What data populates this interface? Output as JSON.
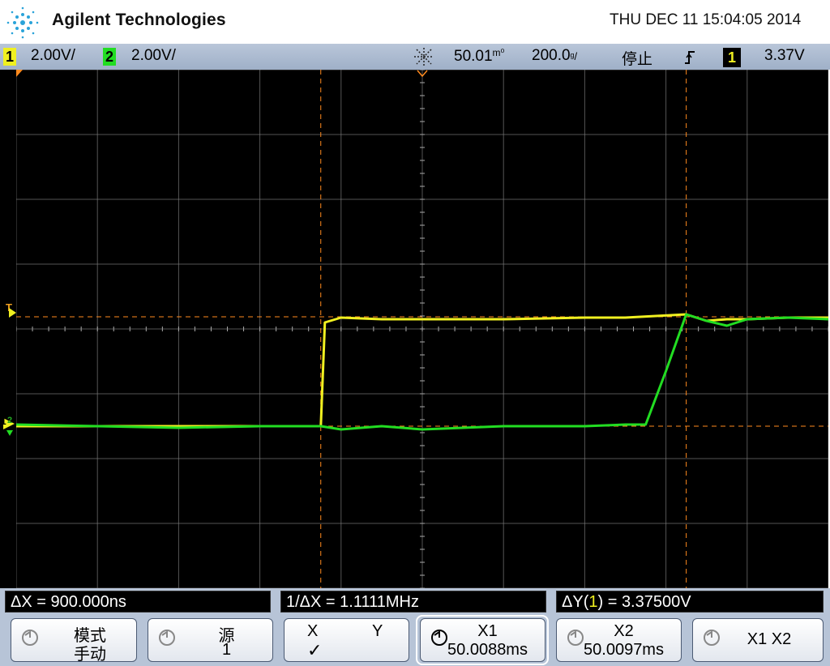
{
  "header": {
    "brand": "Agilent Technologies",
    "datetime": "THU DEC 11 15:04:05 2014"
  },
  "status": {
    "ch1_num": "1",
    "ch1_scale": "2.00V/",
    "ch2_num": "2",
    "ch2_scale": "2.00V/",
    "time_position": "50.01",
    "time_position_unit": "m⁰",
    "timebase": "200.0",
    "timebase_unit": "ᵍ/",
    "run_state": "停止",
    "trigger_slope_icon": "rising-edge-icon",
    "trigger_source": "1",
    "trigger_level": "3.37V"
  },
  "markers": {
    "trigger_level_marker": "T",
    "ch_ground_marker": "1",
    "ch2_ground_marker": "2"
  },
  "readouts": {
    "delta_x": "ΔX = 900.000ns",
    "inv_delta_x": "1/ΔX = 1.1111MHz",
    "delta_y_prefix": "ΔY(",
    "delta_y_channel": "1",
    "delta_y_suffix": ") = 3.37500V"
  },
  "softkeys": {
    "mode_label": "模式",
    "mode_value": "手动",
    "source_label": "源",
    "source_value": "1",
    "x_label": "X",
    "y_label": "Y",
    "x_check": "✓",
    "x1_label": "X1",
    "x1_value": "50.0088ms",
    "x2_label": "X2",
    "x2_value": "50.0097ms",
    "x1x2_label": "X1 X2"
  },
  "colors": {
    "ch1": "#f0f020",
    "ch2": "#22dd22",
    "cursor": "#ff8a1e",
    "grid": "#7a7a7a",
    "statusbar": "#a9b8ce"
  },
  "chart_data": {
    "type": "line",
    "title": "",
    "xlabel": "",
    "ylabel": "",
    "x_unit": "ns",
    "y_unit": "V",
    "xlim": [
      -1000,
      1000
    ],
    "ylim": [
      -8,
      8
    ],
    "grid": true,
    "series": [
      {
        "name": "1",
        "x": [
          -1000,
          -800,
          -600,
          -400,
          -250,
          -240,
          -200,
          -100,
          0,
          200,
          400,
          500,
          650,
          700,
          750,
          800,
          900,
          1000
        ],
        "y": [
          0.0,
          0.0,
          0.0,
          0.0,
          0.0,
          3.2,
          3.35,
          3.3,
          3.3,
          3.3,
          3.35,
          3.35,
          3.45,
          3.25,
          3.3,
          3.3,
          3.35,
          3.35
        ]
      },
      {
        "name": "2",
        "x": [
          -1000,
          -800,
          -600,
          -400,
          -250,
          -200,
          -100,
          0,
          200,
          400,
          500,
          550,
          600,
          650,
          700,
          750,
          800,
          900,
          1000
        ],
        "y": [
          0.05,
          0.0,
          -0.05,
          0.0,
          0.0,
          -0.1,
          0.0,
          -0.1,
          0.0,
          0.0,
          0.05,
          0.05,
          1.7,
          3.45,
          3.25,
          3.1,
          3.3,
          3.35,
          3.3
        ]
      }
    ],
    "cursors": {
      "x1_ms": 50.0088,
      "x2_ms": 50.0097,
      "y1_v": 0.0,
      "y2_v": 3.375,
      "trigger_level_v": 3.37
    }
  }
}
